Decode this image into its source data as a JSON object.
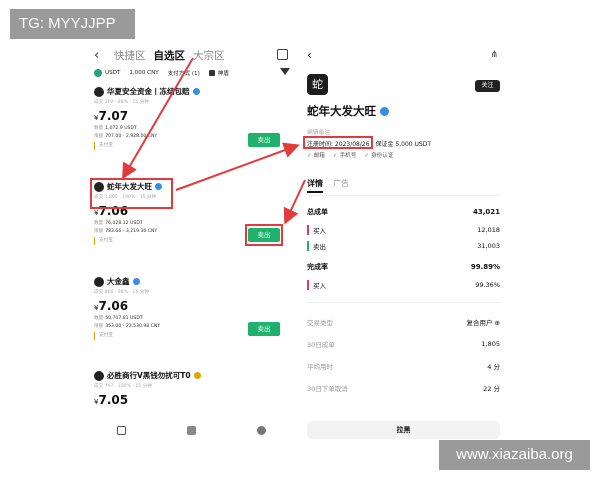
{
  "badges": {
    "tg": "TG: MYYJJPP",
    "watermark": "www.xiazaiba.org"
  },
  "left": {
    "nav": {
      "back": "‹",
      "tabs": [
        "快捷区",
        "自选区",
        "大宗区"
      ]
    },
    "filters": {
      "coin": "USDT",
      "amount": "1,000 CNY",
      "payment": "支付方式 (1)",
      "checkbox": "神盾"
    },
    "merchants": [
      {
        "name": "华夏安全资金丨冻结包赔",
        "stats": "成交 302 · 88% · 15 分钟",
        "price": "7.07",
        "qty_label": "数量",
        "qty": "1,072.9 USDT",
        "limit_label": "限额",
        "limit": "707.00 - 2,928.00 CNY",
        "pay": "支付宝",
        "sell": "卖出"
      },
      {
        "name": "蛇年大发大旺",
        "stats": "成交 1,805 · 100% · 15 分钟",
        "price": "7.06",
        "qty_label": "数量",
        "qty": "76,028.12 USDT",
        "limit_label": "限额",
        "limit": "783.66 - 3,219.36 CNY",
        "pay": "支付宝",
        "sell": "卖出"
      },
      {
        "name": "大金鑫",
        "stats": "成交 866 · 98% · 15 分钟",
        "price": "7.06",
        "qty_label": "数量",
        "qty": "50,707.81 USDT",
        "limit_label": "限额",
        "limit": "353.00 - 23,530.98 CNY",
        "pay": "支付宝",
        "sell": "卖出"
      },
      {
        "name": "必胜商行V黑钱勿扰可T0",
        "stats": "成交 797 · 100% · 15 分钟",
        "price": "7.05"
      }
    ],
    "currency_symbol": "¥"
  },
  "right": {
    "avatar": "蛇",
    "follow": "关注",
    "name": "蛇年大发大旺",
    "remark": "编辑备注",
    "reg_time": "注册时间: 2023/08/26",
    "deposit": "保证金 5,000 USDT",
    "verifications": [
      "邮箱",
      "手机号",
      "身份认证"
    ],
    "tabs": [
      "详情",
      "广告"
    ],
    "stats": [
      {
        "label": "总成单",
        "value": "43,021",
        "type": "main"
      },
      {
        "label": "买入",
        "value": "12,018",
        "type": "sub"
      },
      {
        "label": "卖出",
        "value": "31,003",
        "type": "sub"
      },
      {
        "label": "完成率",
        "value": "99.89%",
        "type": "main"
      },
      {
        "label": "买入",
        "value": "99.36%",
        "type": "sub"
      }
    ],
    "info": [
      {
        "label": "交易类型",
        "value": "复合用户 ⊕"
      },
      {
        "label": "30日成单",
        "value": "1,805"
      },
      {
        "label": "平均用时",
        "value": "4 分"
      },
      {
        "label": "30日下单取消",
        "value": "22 分"
      }
    ],
    "block": "拉黑"
  },
  "colors": {
    "accent_green": "#20b26c",
    "highlight_red": "#e23b3b",
    "verify_blue": "#3a8de0"
  }
}
